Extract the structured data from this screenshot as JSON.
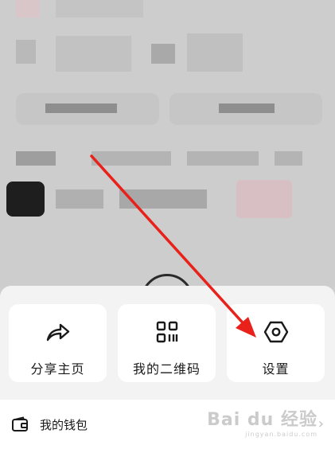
{
  "share_sheet": {
    "actions": [
      {
        "label": "分享主页",
        "icon": "share-arrow-icon"
      },
      {
        "label": "我的二维码",
        "icon": "qr-code-icon"
      },
      {
        "label": "设置",
        "icon": "settings-hexagon-icon"
      }
    ]
  },
  "wallet": {
    "label": "我的钱包",
    "icon": "wallet-icon",
    "chevron": "›"
  },
  "watermark": {
    "text": "Bai du 经验",
    "subtext": "jingyan.baidu.com"
  },
  "colors": {
    "annotation_arrow": "#e8211b",
    "sheet_bg": "#f3f3f3",
    "card_bg": "#ffffff"
  }
}
